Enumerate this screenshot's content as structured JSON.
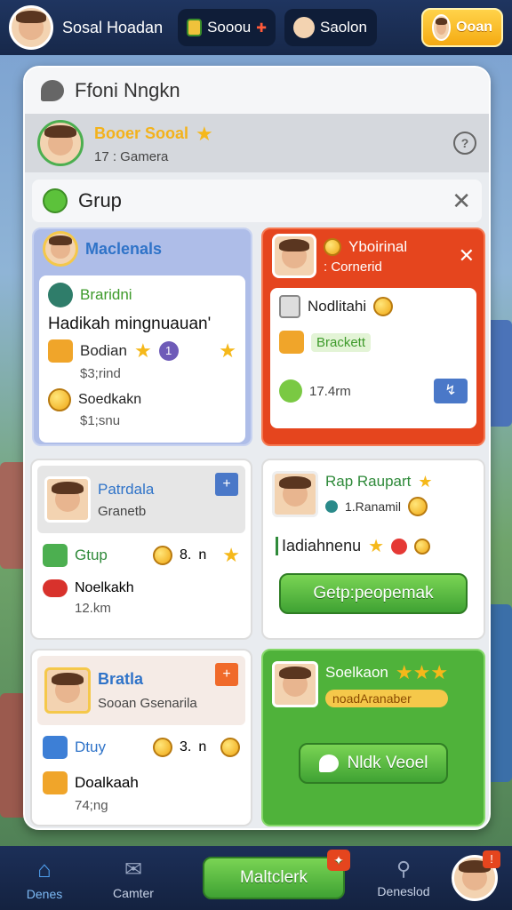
{
  "topbar": {
    "player_name": "Sosal Hoadan",
    "currency1": "Sooou",
    "currency2": "Saolon",
    "gold_button": "Ooan"
  },
  "panel": {
    "title": "Ffoni Nngkn",
    "user": {
      "name": "Booer Sooal",
      "sub": "17 : Gamera"
    },
    "group_label": "Grup"
  },
  "cards": {
    "c1": {
      "title": "Maclenals",
      "tag": "Braridni",
      "headline": "Hadikah mingnuauan'",
      "item1": "Bodian",
      "item1_badge": "1",
      "price": "$3;rind",
      "item2": "Soedkakn",
      "price2": "$1;snu"
    },
    "c2": {
      "title": "Yboirinal",
      "sub": ": Cornerid",
      "item": "Nodlitahi",
      "tag": "Brackett",
      "dist": "17.4rm"
    },
    "c3": {
      "title": "Patrdala",
      "sub": "Granetb",
      "item1": "Gtup",
      "count": "8.",
      "n": "n",
      "item2": "Noelkakh",
      "dist": "12.km"
    },
    "c4": {
      "title": "Rap Raupart",
      "sub": "1.Ranamil",
      "line": "Iadiahnenu",
      "button": "Getp:peopemak"
    },
    "c5": {
      "title": "Bratla",
      "sub": "Sooan Gsenarila",
      "item1": "Dtuy",
      "count": "3.",
      "n": "n",
      "item2": "Doalkaah",
      "dist": "74;ng"
    },
    "c6": {
      "title": "Soelkaon",
      "tag": "noadAranaber",
      "button": "Nldk Veoel"
    }
  },
  "bottomnav": {
    "item1": "Denes",
    "item2": "Camter",
    "center": "Maltclerk",
    "item4": "Deneslod"
  },
  "colors": {
    "gold": "#f5b81a",
    "green": "#4fb23a",
    "red": "#e5451e",
    "navy": "#17284a"
  }
}
